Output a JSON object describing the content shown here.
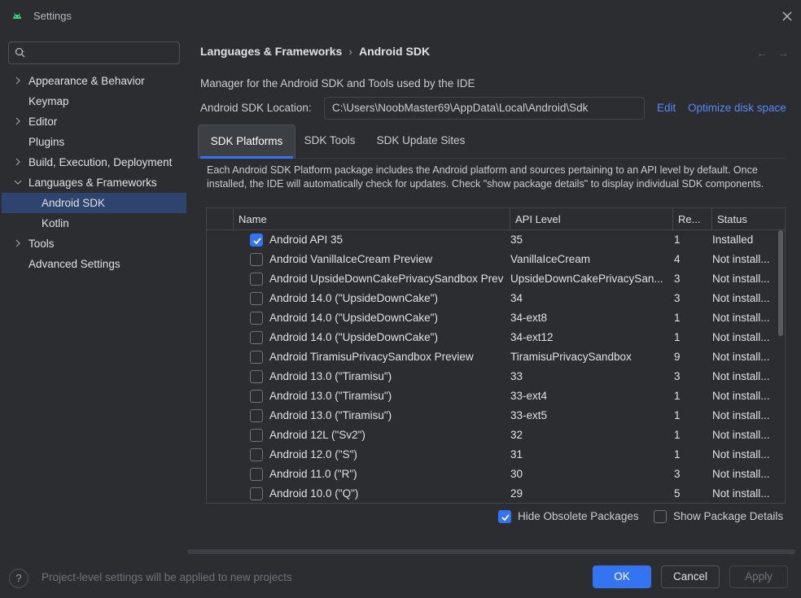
{
  "window": {
    "title": "Settings"
  },
  "search": {
    "placeholder": "",
    "value": ""
  },
  "sidebar": {
    "items": [
      {
        "label": "Appearance & Behavior"
      },
      {
        "label": "Keymap"
      },
      {
        "label": "Editor"
      },
      {
        "label": "Plugins"
      },
      {
        "label": "Build, Execution, Deployment"
      },
      {
        "label": "Languages & Frameworks"
      },
      {
        "label": "Android SDK"
      },
      {
        "label": "Kotlin"
      },
      {
        "label": "Tools"
      },
      {
        "label": "Advanced Settings"
      }
    ]
  },
  "breadcrumb": {
    "parent": "Languages & Frameworks",
    "separator": "›",
    "current": "Android SDK"
  },
  "nav": {
    "back": "←",
    "forward": "→"
  },
  "description": "Manager for the Android SDK and Tools used by the IDE",
  "sdk_location": {
    "label": "Android SDK Location:",
    "value": "C:\\Users\\NoobMaster69\\AppData\\Local\\Android\\Sdk",
    "edit_link": "Edit",
    "optimize_link": "Optimize disk space"
  },
  "tabs": [
    {
      "label": "SDK Platforms",
      "active": true
    },
    {
      "label": "SDK Tools",
      "active": false
    },
    {
      "label": "SDK Update Sites",
      "active": false
    }
  ],
  "info_text": "Each Android SDK Platform package includes the Android platform and sources pertaining to an API level by default. Once installed, the IDE will automatically check for updates. Check \"show package details\" to display individual SDK components.",
  "table": {
    "headers": {
      "name": "Name",
      "api": "API Level",
      "rev": "Re...",
      "status": "Status"
    },
    "rows": [
      {
        "checked": true,
        "name": "Android API 35",
        "api": "35",
        "rev": "1",
        "status": "Installed"
      },
      {
        "checked": false,
        "name": "Android VanillaIceCream Preview",
        "api": "VanillaIceCream",
        "rev": "4",
        "status": "Not install..."
      },
      {
        "checked": false,
        "name": "Android UpsideDownCakePrivacySandbox Prev",
        "api": "UpsideDownCakePrivacySan...",
        "rev": "3",
        "status": "Not install..."
      },
      {
        "checked": false,
        "name": "Android 14.0 (\"UpsideDownCake\")",
        "api": "34",
        "rev": "3",
        "status": "Not install..."
      },
      {
        "checked": false,
        "name": "Android 14.0 (\"UpsideDownCake\")",
        "api": "34-ext8",
        "rev": "1",
        "status": "Not install..."
      },
      {
        "checked": false,
        "name": "Android 14.0 (\"UpsideDownCake\")",
        "api": "34-ext12",
        "rev": "1",
        "status": "Not install..."
      },
      {
        "checked": false,
        "name": "Android TiramisuPrivacySandbox Preview",
        "api": "TiramisuPrivacySandbox",
        "rev": "9",
        "status": "Not install..."
      },
      {
        "checked": false,
        "name": "Android 13.0 (\"Tiramisu\")",
        "api": "33",
        "rev": "3",
        "status": "Not install..."
      },
      {
        "checked": false,
        "name": "Android 13.0 (\"Tiramisu\")",
        "api": "33-ext4",
        "rev": "1",
        "status": "Not install..."
      },
      {
        "checked": false,
        "name": "Android 13.0 (\"Tiramisu\")",
        "api": "33-ext5",
        "rev": "1",
        "status": "Not install..."
      },
      {
        "checked": false,
        "name": "Android 12L (\"Sv2\")",
        "api": "32",
        "rev": "1",
        "status": "Not install..."
      },
      {
        "checked": false,
        "name": "Android 12.0 (\"S\")",
        "api": "31",
        "rev": "1",
        "status": "Not install..."
      },
      {
        "checked": false,
        "name": "Android 11.0 (\"R\")",
        "api": "30",
        "rev": "3",
        "status": "Not install..."
      },
      {
        "checked": false,
        "name": "Android 10.0 (\"Q\")",
        "api": "29",
        "rev": "5",
        "status": "Not install..."
      }
    ]
  },
  "options": {
    "hide_obsolete": {
      "label": "Hide Obsolete Packages",
      "checked": true
    },
    "show_details": {
      "label": "Show Package Details",
      "checked": false
    }
  },
  "footer": {
    "help": "?",
    "note": "Project-level settings will be applied to new projects",
    "ok": "OK",
    "cancel": "Cancel",
    "apply": "Apply"
  },
  "colors": {
    "accent": "#3574f0",
    "link": "#548af7",
    "background": "#2b2d30",
    "selection": "#2e436e"
  }
}
